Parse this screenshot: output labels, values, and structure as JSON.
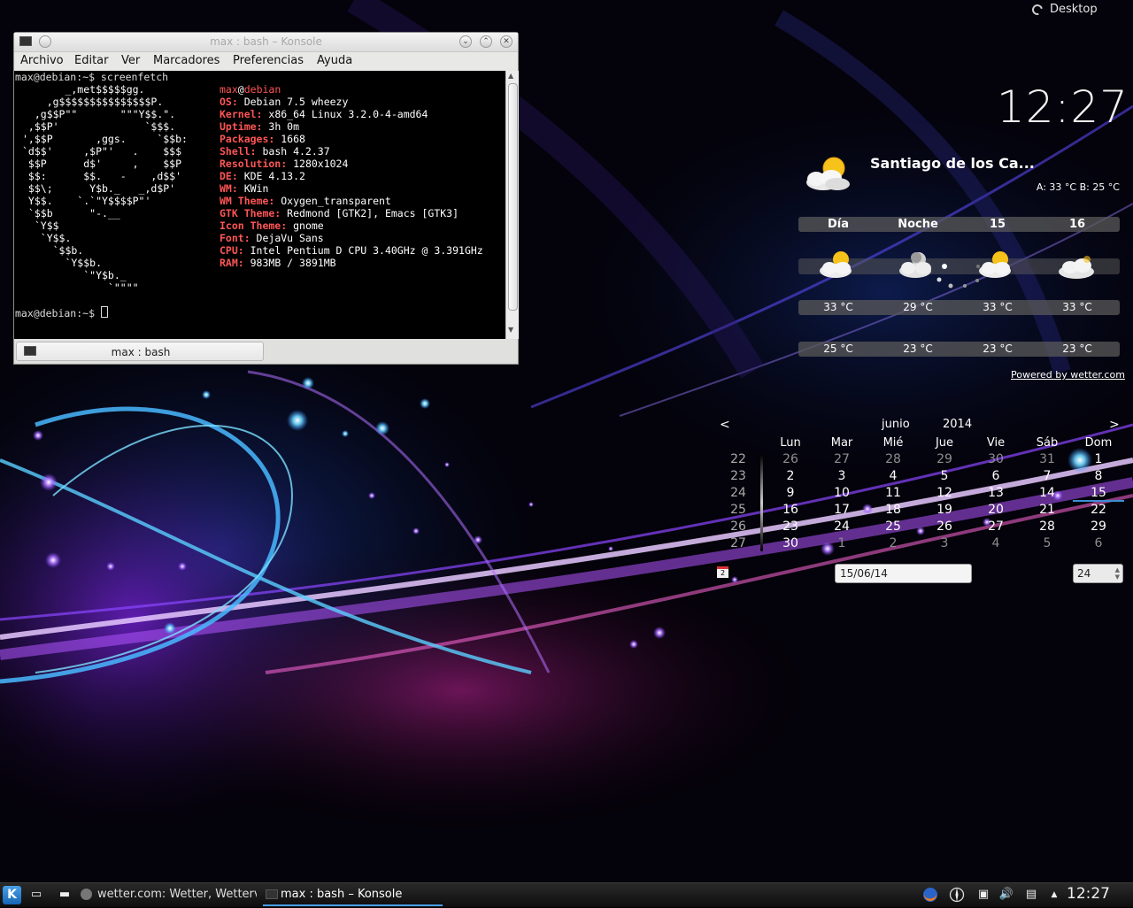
{
  "desktop": {
    "toolbox_label": "Desktop"
  },
  "clock": {
    "time": "12:27"
  },
  "weather": {
    "location": "Santiago de los Ca...",
    "current": "A: 33 °C B: 25 °C",
    "current_icon": "partly-cloudy-sun-icon",
    "columns": [
      {
        "header": "Día",
        "icon": "partly-cloudy-sun-icon",
        "high": "33 °C",
        "low": "25 °C"
      },
      {
        "header": "Noche",
        "icon": "partly-cloudy-moon-icon",
        "high": "29 °C",
        "low": "23 °C"
      },
      {
        "header": "15",
        "icon": "partly-cloudy-sun-icon",
        "high": "33 °C",
        "low": "23 °C"
      },
      {
        "header": "16",
        "icon": "cloudy-icon",
        "high": "33 °C",
        "low": "23 °C"
      }
    ],
    "powered_by": "Powered by wetter.com"
  },
  "calendar": {
    "prev": "<",
    "next": ">",
    "month": "junio",
    "year": "2014",
    "weekdays": [
      "Lun",
      "Mar",
      "Mié",
      "Jue",
      "Vie",
      "Sáb",
      "Dom"
    ],
    "weeks": [
      {
        "num": "22",
        "days": [
          "26",
          "27",
          "28",
          "29",
          "30",
          "31",
          "1"
        ]
      },
      {
        "num": "23",
        "days": [
          "2",
          "3",
          "4",
          "5",
          "6",
          "7",
          "8"
        ]
      },
      {
        "num": "24",
        "days": [
          "9",
          "10",
          "11",
          "12",
          "13",
          "14",
          "15"
        ]
      },
      {
        "num": "25",
        "days": [
          "16",
          "17",
          "18",
          "19",
          "20",
          "21",
          "22"
        ]
      },
      {
        "num": "26",
        "days": [
          "23",
          "24",
          "25",
          "26",
          "27",
          "28",
          "29"
        ]
      },
      {
        "num": "27",
        "days": [
          "30",
          "1",
          "2",
          "3",
          "4",
          "5",
          "6"
        ]
      }
    ],
    "today": "15",
    "date_icon_label": "2",
    "date_input": "15/06/14",
    "week_spin": "24"
  },
  "konsole": {
    "title": "max : bash – Konsole",
    "menu": [
      "Archivo",
      "Editar",
      "Ver",
      "Marcadores",
      "Preferencias",
      "Ayuda"
    ],
    "tab_label": "max : bash",
    "command_line": "max@debian:~$ screenfetch",
    "prompt_line": "max@debian:~$ ",
    "logo": [
      "       _,met$$$$$gg.",
      "    ,g$$$$$$$$$$$$$$$P.",
      "  ,g$$P\"\"       \"\"\"Y$$.\".",
      " ,$$P'              `$$$.",
      "',$$P       ,ggs.     `$$b:",
      "`d$$'     ,$P\"'   .    $$$",
      " $$P      d$'     ,    $$P",
      " $$:      $$.   -    ,d$$'",
      " $$\\;      Y$b._   _,d$P'",
      " Y$$.    `.`\"Y$$$$P\"'",
      " `$$b      \"-.__",
      "  `Y$$",
      "   `Y$$.",
      "     `$$b.",
      "       `Y$$b.",
      "          `\"Y$b._",
      "              `\"\"\"\""
    ],
    "user": "max",
    "at": "@",
    "host": "debian",
    "info": [
      {
        "label": "OS:",
        "value": " Debian 7.5 wheezy"
      },
      {
        "label": "Kernel:",
        "value": " x86_64 Linux 3.2.0-4-amd64"
      },
      {
        "label": "Uptime:",
        "value": " 3h 0m"
      },
      {
        "label": "Packages:",
        "value": " 1668"
      },
      {
        "label": "Shell:",
        "value": " bash 4.2.37"
      },
      {
        "label": "Resolution:",
        "value": " 1280x1024"
      },
      {
        "label": "DE:",
        "value": " KDE 4.13.2"
      },
      {
        "label": "WM:",
        "value": " KWin"
      },
      {
        "label": "WM Theme:",
        "value": " Oxygen_transparent"
      },
      {
        "label": "GTK Theme:",
        "value": " Redmond [GTK2], Emacs [GTK3]"
      },
      {
        "label": "Icon Theme:",
        "value": " gnome"
      },
      {
        "label": "Font:",
        "value": " DejaVu Sans"
      },
      {
        "label": "CPU:",
        "value": " Intel Pentium D CPU 3.40GHz @ 3.391GHz"
      },
      {
        "label": "RAM:",
        "value": " 983MB / 3891MB"
      }
    ]
  },
  "taskbar": {
    "kmenu_label": "K",
    "tasks": [
      {
        "label": "wetter.com: Wetter, Wetterv"
      },
      {
        "label": "max : bash – Konsole"
      }
    ],
    "clock": "12:27"
  }
}
